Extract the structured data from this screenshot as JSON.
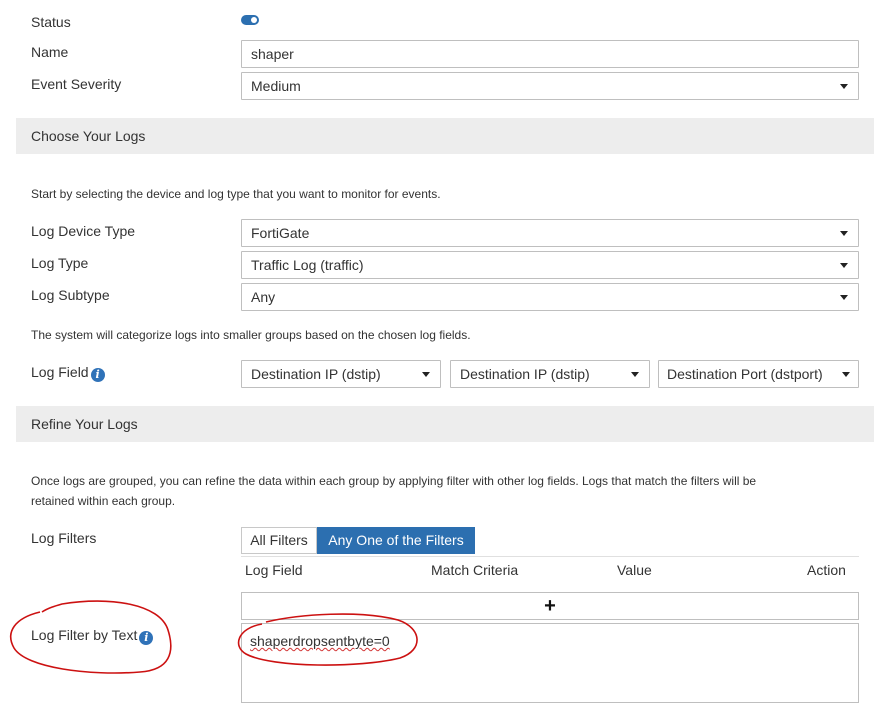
{
  "form": {
    "status_label": "Status",
    "status_on": true,
    "name_label": "Name",
    "name_value": "shaper",
    "severity_label": "Event Severity",
    "severity_value": "Medium"
  },
  "choose_logs": {
    "title": "Choose Your Logs",
    "description": "Start by selecting the device and log type that you want to monitor for events.",
    "device_type_label": "Log Device Type",
    "device_type_value": "FortiGate",
    "log_type_label": "Log Type",
    "log_type_value": "Traffic Log (traffic)",
    "subtype_label": "Log Subtype",
    "subtype_value": "Any",
    "group_description": "The system will categorize logs into smaller groups based on the chosen log fields.",
    "log_field_label": "Log Field",
    "log_fields": [
      "Destination IP (dstip)",
      "Destination IP (dstip)",
      "Destination Port (dstport)"
    ]
  },
  "refine_logs": {
    "title": "Refine Your Logs",
    "description_line1": "Once logs are grouped, you can refine the data within each group by applying filter with other log fields. Logs that match the filters will be",
    "description_line2": "retained within each group.",
    "filters_label": "Log Filters",
    "filter_mode_all": "All Filters",
    "filter_mode_any": "Any One of the Filters",
    "selected_mode": "Any One of the Filters",
    "columns": [
      "Log Field",
      "Match Criteria",
      "Value",
      "Action"
    ],
    "add_symbol": "+",
    "filter_by_text_label": "Log Filter by Text",
    "filter_text_value": "shaperdropsentbyte=0"
  },
  "colors": {
    "accent": "#2c6fb0",
    "section_bg": "#ededed",
    "annotation_red": "#cc1111"
  },
  "icons": {
    "toggle": "toggle-switch-icon",
    "dropdown": "caret-down-icon",
    "info": "info-circle-icon",
    "add": "plus-icon"
  }
}
